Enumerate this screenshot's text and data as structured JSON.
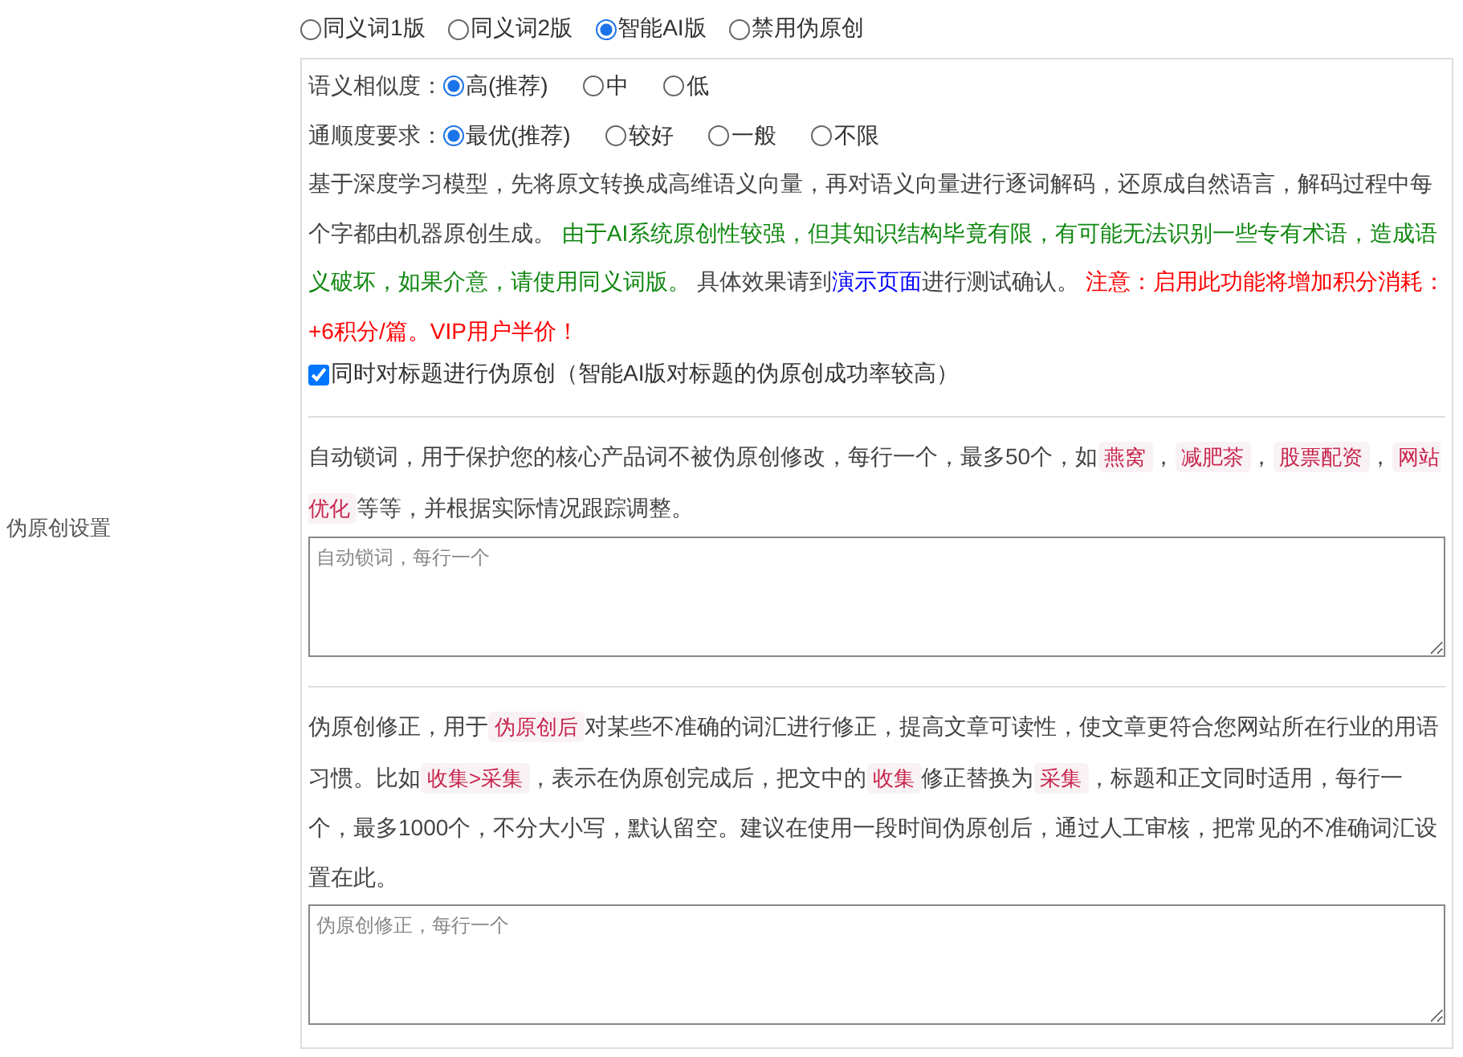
{
  "section_label": "伪原创设置",
  "modes": [
    {
      "label": "同义词1版",
      "selected": false
    },
    {
      "label": "同义词2版",
      "selected": false
    },
    {
      "label": "智能AI版",
      "selected": true
    },
    {
      "label": "禁用伪原创",
      "selected": false
    }
  ],
  "option_groups": [
    {
      "label": "语义相似度：",
      "options": [
        {
          "label": "高(推荐)",
          "selected": true
        },
        {
          "label": "中",
          "selected": false
        },
        {
          "label": "低",
          "selected": false
        }
      ]
    },
    {
      "label": "通顺度要求：",
      "options": [
        {
          "label": "最优(推荐)",
          "selected": true
        },
        {
          "label": "较好",
          "selected": false
        },
        {
          "label": "一般",
          "selected": false
        },
        {
          "label": "不限",
          "selected": false
        }
      ]
    }
  ],
  "description": [
    {
      "kind": "plain",
      "text": "基于深度学习模型，先将原文转换成高维语义向量，再对语义向量进行逐词解码，还原成自然语言，解码过程中每个字都由机器原创生成。 "
    },
    {
      "kind": "notice",
      "text": "由于AI系统原创性较强，但其知识结构毕竟有限，有可能无法识别一些专有术语，造成语义破坏，如果介意，请使用同义词版。"
    },
    {
      "kind": "plain",
      "text": " 具体效果请到"
    },
    {
      "kind": "link",
      "text": "演示页面"
    },
    {
      "kind": "plain",
      "text": "进行测试确认。 "
    },
    {
      "kind": "warning",
      "text": "注意：启用此功能将增加积分消耗：+6积分/篇。VIP用户半价！"
    }
  ],
  "title_option": {
    "label": "同时对标题进行伪原创（智能AI版对标题的伪原创成功率较高）",
    "checked": true
  },
  "lock_words": {
    "description": [
      {
        "kind": "plain",
        "text": "自动锁词，用于保护您的核心产品词不被伪原创修改，每行一个，最多50个，如"
      },
      {
        "kind": "tag",
        "text": "燕窝"
      },
      {
        "kind": "plain",
        "text": "，"
      },
      {
        "kind": "tag",
        "text": "减肥茶"
      },
      {
        "kind": "plain",
        "text": "，"
      },
      {
        "kind": "tag",
        "text": "股票配资"
      },
      {
        "kind": "plain",
        "text": "，"
      },
      {
        "kind": "tag",
        "text": "网站优化"
      },
      {
        "kind": "plain",
        "text": "等等，并根据实际情况跟踪调整。"
      }
    ],
    "placeholder": "自动锁词，每行一个"
  },
  "corrections": {
    "description": [
      {
        "kind": "plain",
        "text": "伪原创修正，用于"
      },
      {
        "kind": "tag",
        "text": "伪原创后"
      },
      {
        "kind": "plain",
        "text": "对某些不准确的词汇进行修正，提高文章可读性，使文章更符合您网站所在行业的用语习惯。比如"
      },
      {
        "kind": "tag",
        "text": "收集>采集"
      },
      {
        "kind": "plain",
        "text": "，表示在伪原创完成后，把文中的"
      },
      {
        "kind": "tag",
        "text": "收集"
      },
      {
        "kind": "plain",
        "text": "修正替换为"
      },
      {
        "kind": "tag",
        "text": "采集"
      },
      {
        "kind": "plain",
        "text": "，标题和正文同时适用，每行一个，最多1000个，不分大小写，默认留空。建议在使用一段时间伪原创后，通过人工审核，把常见的不准确词汇设置在此。"
      }
    ],
    "placeholder": "伪原创修正，每行一个"
  }
}
